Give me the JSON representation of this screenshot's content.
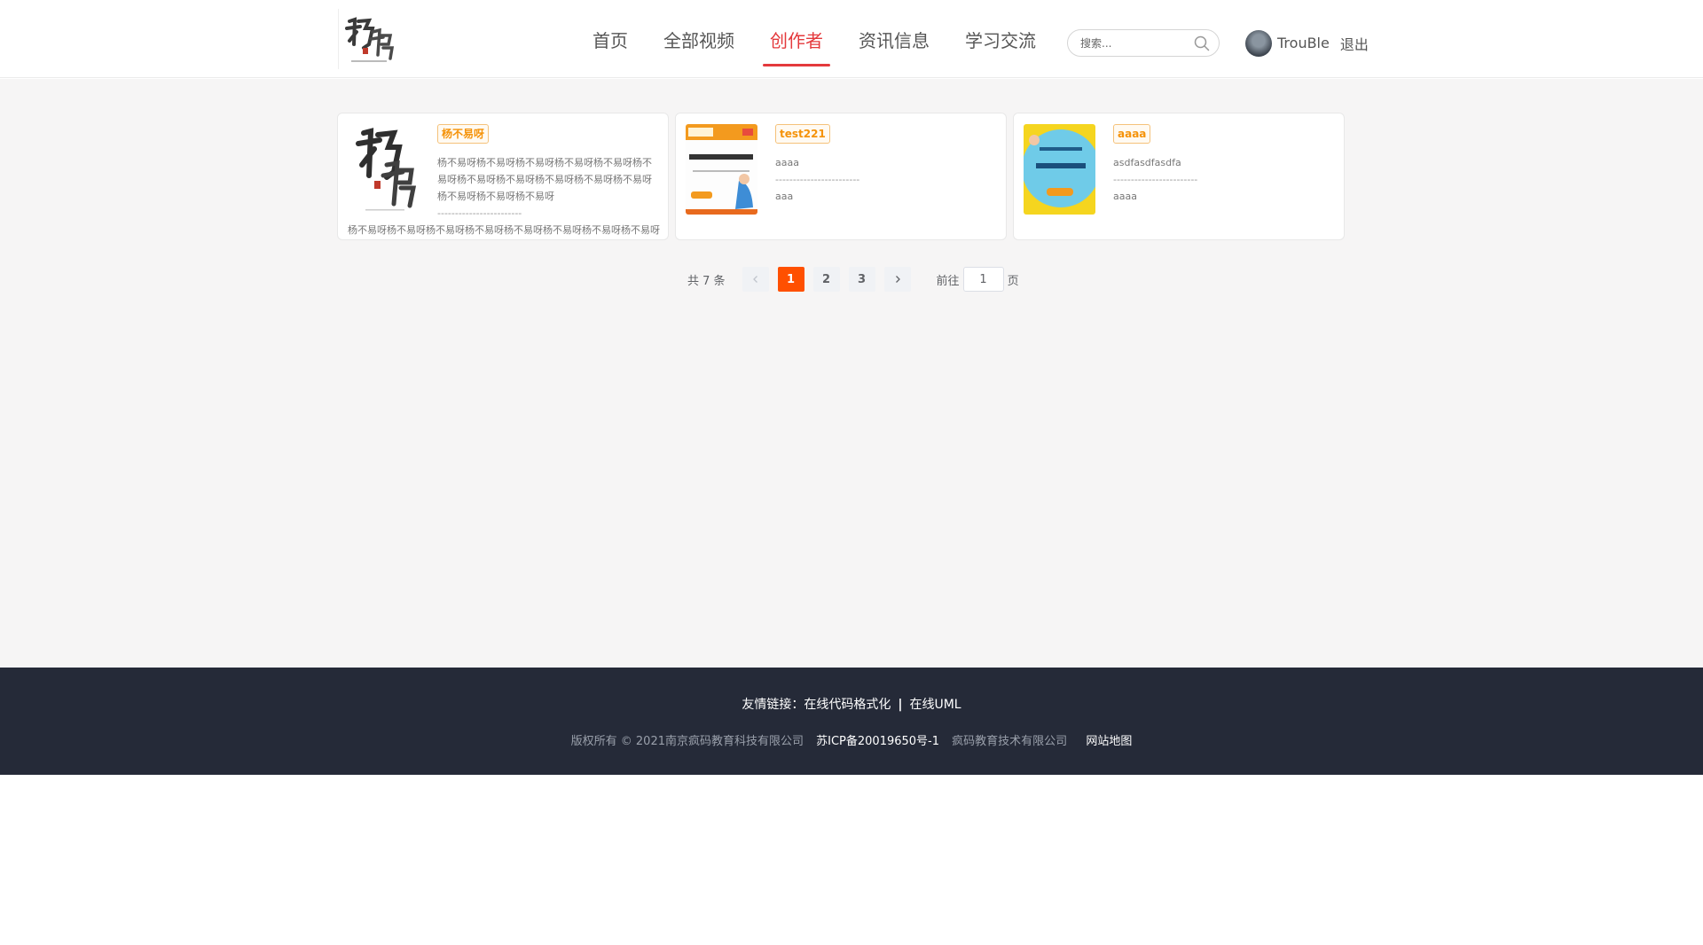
{
  "header": {
    "nav": [
      {
        "label": "首页",
        "active": false
      },
      {
        "label": "全部视频",
        "active": false
      },
      {
        "label": "创作者",
        "active": true
      },
      {
        "label": "资讯信息",
        "active": false
      },
      {
        "label": "学习交流",
        "active": false
      }
    ],
    "search_placeholder": "搜索...",
    "username": "TrouBle",
    "logout_label": "退出",
    "accent_color": "#e4393c"
  },
  "creators": [
    {
      "name": "杨不易呀",
      "desc": "杨不易呀杨不易呀杨不易呀杨不易呀杨不易呀杨不易呀杨不易呀杨不易呀杨不易呀杨不易呀杨不易呀杨不易呀杨不易呀杨不易呀",
      "sep": "------------------------",
      "extra": "杨不易呀杨不易呀杨不易呀杨不易呀杨不易呀杨不易呀杨不易呀杨不易呀"
    },
    {
      "name": "test221",
      "desc": "aaaa",
      "sep": "------------------------",
      "extra_inline": "aaa"
    },
    {
      "name": "aaaa",
      "desc": "asdfasdfasdfa",
      "sep": "------------------------",
      "extra_inline": "aaaa"
    }
  ],
  "pagination": {
    "total_label": "共 7 条",
    "pages": [
      "1",
      "2",
      "3"
    ],
    "current_page": 1,
    "goto_prefix": "前往",
    "goto_value": "1",
    "goto_suffix": "页",
    "active_color": "#ff5000"
  },
  "footer": {
    "friend_prefix": "友情链接：",
    "links": [
      "在线代码格式化",
      "在线UML"
    ],
    "link_sep": "|",
    "copyright": "版权所有 © 2021南京疯码教育科技有限公司",
    "icp": "苏ICP备20019650号-1",
    "company": "疯码教育技术有限公司",
    "sitemap": "网站地图",
    "bg_color": "#252a38"
  }
}
